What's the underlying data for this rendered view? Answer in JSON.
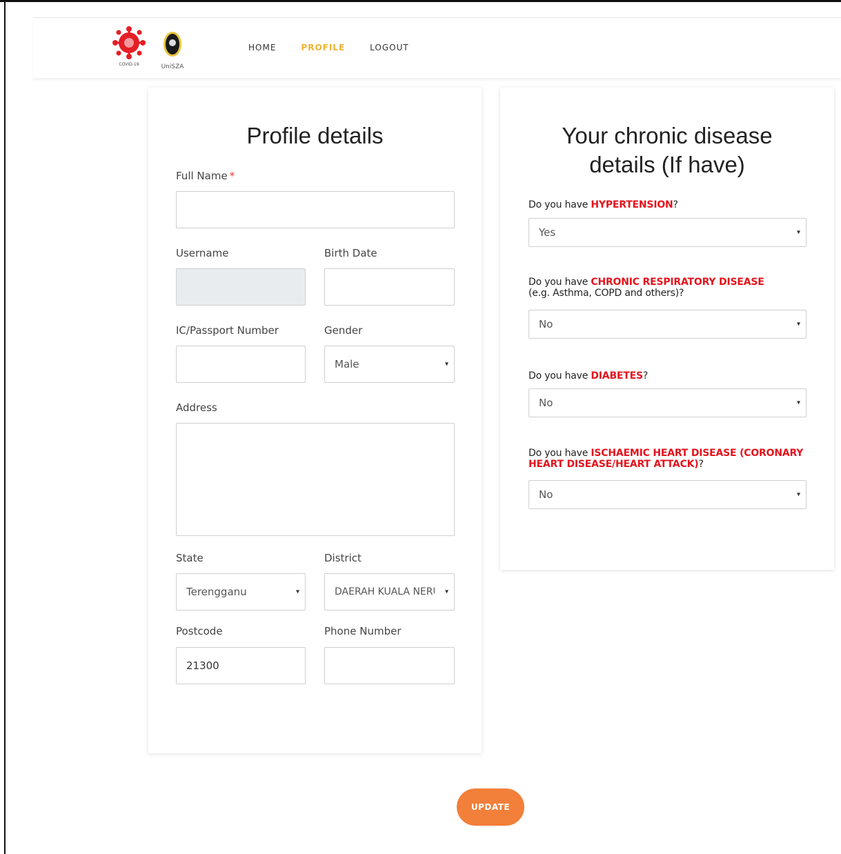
{
  "nav": {
    "home": "HOME",
    "profile": "PROFILE",
    "logout": "LOGOUT"
  },
  "logos": {
    "virus_text": "COVID-19",
    "unisza_text": "UniSZA"
  },
  "profile": {
    "title": "Profile details",
    "full_name_label": "Full Name",
    "required_mark": "*",
    "full_name_value": "",
    "username_label": "Username",
    "username_value": "",
    "birth_date_label": "Birth Date",
    "birth_date_value": "",
    "ic_label": "IC/Passport Number",
    "ic_value": "",
    "gender_label": "Gender",
    "gender_value": "Male",
    "address_label": "Address",
    "address_value": "",
    "state_label": "State",
    "state_value": "Terengganu",
    "district_label": "District",
    "district_value": "DAERAH KUALA NERUS",
    "postcode_label": "Postcode",
    "postcode_value": "21300",
    "phone_label": "Phone Number",
    "phone_value": ""
  },
  "chronic": {
    "title_line1": "Your chronic disease",
    "title_line2": "details (If have)",
    "q_prefix": "Do you have ",
    "q_suffix": "?",
    "hypertension_term": "HYPERTENSION",
    "hypertension_value": "Yes",
    "respiratory_term": "CHRONIC RESPIRATORY DISEASE",
    "respiratory_note": "(e.g. Asthma, COPD and others)?",
    "respiratory_value": "No",
    "diabetes_term": "DIABETES",
    "diabetes_value": "No",
    "ihd_term_line1": "ISCHAEMIC HEART DISEASE (CORONARY",
    "ihd_term_line2": "HEART DISEASE/HEART ATTACK)",
    "ihd_value": "No"
  },
  "actions": {
    "update_label": "UPDATE"
  },
  "colors": {
    "accent": "#f27f3a",
    "nav_active": "#f0b232",
    "highlight": "#e4141d"
  },
  "icons": {
    "caret": "▾",
    "flags": [
      "malaysia-flag-icon",
      "uk-flag-icon"
    ]
  }
}
